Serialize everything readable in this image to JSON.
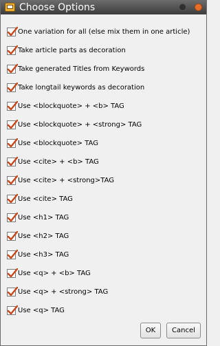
{
  "window": {
    "title": "Choose Options",
    "icon": "options-app-icon"
  },
  "options": [
    {
      "label": "One variation for all (else mix them in one article)",
      "checked": true
    },
    {
      "label": "Take article parts as decoration",
      "checked": true
    },
    {
      "label": "Take generated Titles from Keywords",
      "checked": true
    },
    {
      "label": "Take longtail keywords as decoration",
      "checked": true
    },
    {
      "label": "Use <blockquote> + <b> TAG",
      "checked": true
    },
    {
      "label": "Use <blockquote> + <strong> TAG",
      "checked": true
    },
    {
      "label": "Use <blockquote> TAG",
      "checked": true
    },
    {
      "label": "Use <cite> + <b> TAG",
      "checked": true
    },
    {
      "label": "Use <cite> + <strong>TAG",
      "checked": true
    },
    {
      "label": "Use <cite> TAG",
      "checked": true
    },
    {
      "label": "Use <h1> TAG",
      "checked": true
    },
    {
      "label": "Use <h2> TAG",
      "checked": true
    },
    {
      "label": "Use <h3> TAG",
      "checked": true
    },
    {
      "label": "Use <q> + <b> TAG",
      "checked": true
    },
    {
      "label": "Use <q> + <strong> TAG",
      "checked": true
    },
    {
      "label": "Use <q> TAG",
      "checked": true
    }
  ],
  "buttons": {
    "ok": "OK",
    "cancel": "Cancel"
  },
  "colors": {
    "check": "#c8461a",
    "titlebar": "#4a4a4a",
    "close": "#e6702a"
  }
}
